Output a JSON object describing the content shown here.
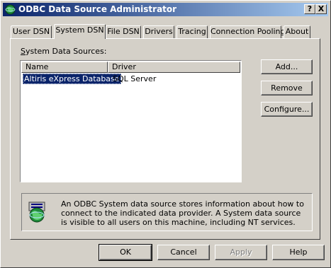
{
  "window": {
    "title": "ODBC Data Source Administrator",
    "help_btn": "?",
    "close_btn": "X"
  },
  "tabs": [
    {
      "label": "User DSN"
    },
    {
      "label": "System DSN"
    },
    {
      "label": "File DSN"
    },
    {
      "label": "Drivers"
    },
    {
      "label": "Tracing"
    },
    {
      "label": "Connection Pooling"
    },
    {
      "label": "About"
    }
  ],
  "active_tab": "System DSN",
  "section_label": "System Data Sources:",
  "list": {
    "columns": [
      "Name",
      "Driver"
    ],
    "rows": [
      {
        "name": "Altiris eXpress Database",
        "driver": "SQL Server"
      }
    ]
  },
  "side_buttons": {
    "add": "Add...",
    "remove": "Remove",
    "configure": "Configure..."
  },
  "info_text": "An ODBC System data source stores information about how to connect to the indicated data provider.   A System data source is visible to all users on this machine, including NT services.",
  "bottom_buttons": {
    "ok": "OK",
    "cancel": "Cancel",
    "apply": "Apply",
    "help": "Help"
  },
  "icons": {
    "app": "odbc-globe-icon",
    "info": "database-globe-icon"
  },
  "colors": {
    "titlebar_start": "#0a246a",
    "titlebar_end": "#a6caf0",
    "selection": "#0a246a",
    "face": "#d4d0c8"
  }
}
